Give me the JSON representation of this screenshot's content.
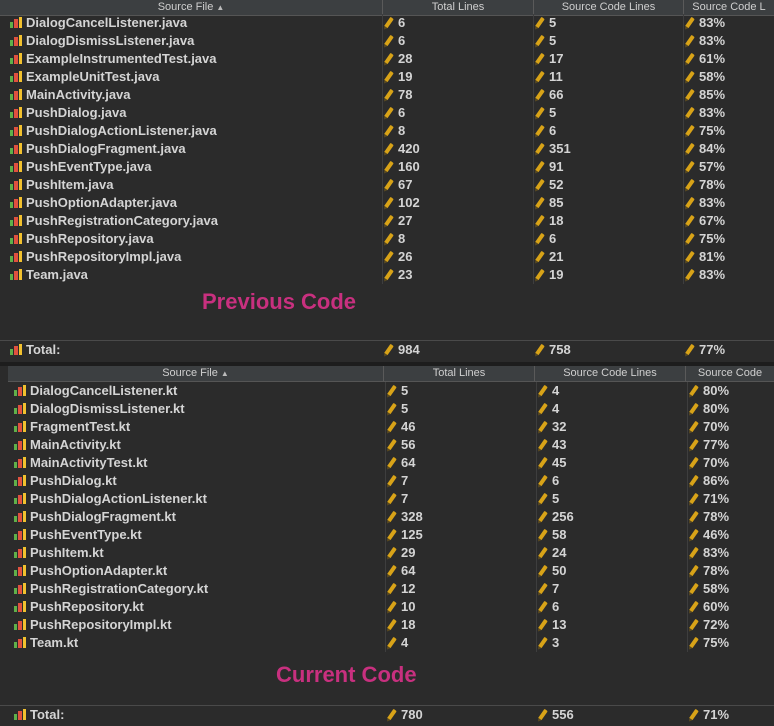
{
  "colors": {
    "background": "#2b2b2b",
    "header": "#3c3f41",
    "label": "#c8307f",
    "text": "#d4d4d4"
  },
  "icons": {
    "file": "bar-chart-icon",
    "metric": "pencil-icon"
  },
  "previous": {
    "label": "Previous Code",
    "headers": [
      "Source File",
      "Total Lines",
      "Source Code Lines",
      "Source Code L"
    ],
    "rows": [
      {
        "file": "DialogCancelListener.java",
        "total": "6",
        "source": "5",
        "pct": "83%"
      },
      {
        "file": "DialogDismissListener.java",
        "total": "6",
        "source": "5",
        "pct": "83%"
      },
      {
        "file": "ExampleInstrumentedTest.java",
        "total": "28",
        "source": "17",
        "pct": "61%"
      },
      {
        "file": "ExampleUnitTest.java",
        "total": "19",
        "source": "11",
        "pct": "58%"
      },
      {
        "file": "MainActivity.java",
        "total": "78",
        "source": "66",
        "pct": "85%"
      },
      {
        "file": "PushDialog.java",
        "total": "6",
        "source": "5",
        "pct": "83%"
      },
      {
        "file": "PushDialogActionListener.java",
        "total": "8",
        "source": "6",
        "pct": "75%"
      },
      {
        "file": "PushDialogFragment.java",
        "total": "420",
        "source": "351",
        "pct": "84%"
      },
      {
        "file": "PushEventType.java",
        "total": "160",
        "source": "91",
        "pct": "57%"
      },
      {
        "file": "PushItem.java",
        "total": "67",
        "source": "52",
        "pct": "78%"
      },
      {
        "file": "PushOptionAdapter.java",
        "total": "102",
        "source": "85",
        "pct": "83%"
      },
      {
        "file": "PushRegistrationCategory.java",
        "total": "27",
        "source": "18",
        "pct": "67%"
      },
      {
        "file": "PushRepository.java",
        "total": "8",
        "source": "6",
        "pct": "75%"
      },
      {
        "file": "PushRepositoryImpl.java",
        "total": "26",
        "source": "21",
        "pct": "81%"
      },
      {
        "file": "Team.java",
        "total": "23",
        "source": "19",
        "pct": "83%"
      }
    ],
    "totals": {
      "label": "Total:",
      "total": "984",
      "source": "758",
      "pct": "77%"
    }
  },
  "current": {
    "label": "Current Code",
    "headers": [
      "Source File",
      "Total Lines",
      "Source Code Lines",
      "Source Code"
    ],
    "rows": [
      {
        "file": "DialogCancelListener.kt",
        "total": "5",
        "source": "4",
        "pct": "80%"
      },
      {
        "file": "DialogDismissListener.kt",
        "total": "5",
        "source": "4",
        "pct": "80%"
      },
      {
        "file": "FragmentTest.kt",
        "total": "46",
        "source": "32",
        "pct": "70%"
      },
      {
        "file": "MainActivity.kt",
        "total": "56",
        "source": "43",
        "pct": "77%"
      },
      {
        "file": "MainActivityTest.kt",
        "total": "64",
        "source": "45",
        "pct": "70%"
      },
      {
        "file": "PushDialog.kt",
        "total": "7",
        "source": "6",
        "pct": "86%"
      },
      {
        "file": "PushDialogActionListener.kt",
        "total": "7",
        "source": "5",
        "pct": "71%"
      },
      {
        "file": "PushDialogFragment.kt",
        "total": "328",
        "source": "256",
        "pct": "78%"
      },
      {
        "file": "PushEventType.kt",
        "total": "125",
        "source": "58",
        "pct": "46%"
      },
      {
        "file": "PushItem.kt",
        "total": "29",
        "source": "24",
        "pct": "83%"
      },
      {
        "file": "PushOptionAdapter.kt",
        "total": "64",
        "source": "50",
        "pct": "78%"
      },
      {
        "file": "PushRegistrationCategory.kt",
        "total": "12",
        "source": "7",
        "pct": "58%"
      },
      {
        "file": "PushRepository.kt",
        "total": "10",
        "source": "6",
        "pct": "60%"
      },
      {
        "file": "PushRepositoryImpl.kt",
        "total": "18",
        "source": "13",
        "pct": "72%"
      },
      {
        "file": "Team.kt",
        "total": "4",
        "source": "3",
        "pct": "75%"
      }
    ],
    "totals": {
      "label": "Total:",
      "total": "780",
      "source": "556",
      "pct": "71%"
    }
  }
}
